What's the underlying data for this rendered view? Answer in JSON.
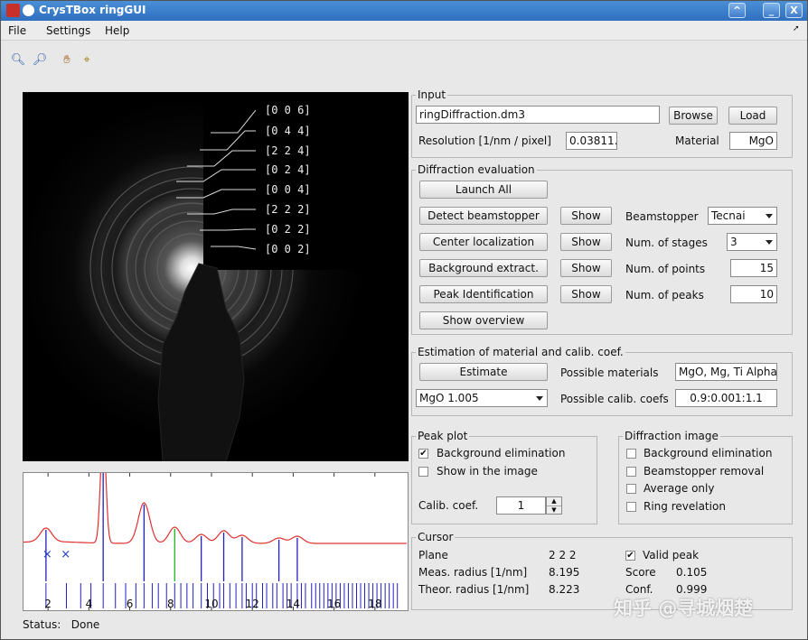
{
  "window": {
    "title": "CrysTBox ringGUI",
    "buttons": [
      "^",
      "_",
      "X"
    ]
  },
  "menu": [
    "File",
    "Settings",
    "Help"
  ],
  "toolbar": {
    "icons": [
      "zoom-in-icon",
      "zoom-out-icon",
      "pan-hand-icon",
      "data-cursor-icon"
    ]
  },
  "image": {
    "planes": [
      "[0  0  6]",
      "[0  4  4]",
      "[2  2  4]",
      "[0  2  4]",
      "[0  0  4]",
      "[2  2  2]",
      "[0  2  2]",
      "[0  0  2]"
    ]
  },
  "plot": {
    "xticks": [
      "2",
      "4",
      "6",
      "8",
      "10",
      "12",
      "14",
      "16",
      "18"
    ],
    "xlim": [
      0.8,
      19.6
    ],
    "peaks": [
      1.9,
      4.7,
      6.7,
      8.2,
      9.5,
      10.6,
      11.5,
      13.3,
      14.2
    ],
    "highlight_peak": 8.2,
    "theor_lines": [
      1.9,
      2.9,
      3.6,
      4.1,
      4.7,
      5.3,
      5.8,
      6.3,
      6.7,
      7.1,
      7.4,
      7.8,
      8.2,
      8.5,
      8.8,
      9.1,
      9.5,
      9.8,
      10.1,
      10.4,
      10.6,
      10.9,
      11.2,
      11.5,
      11.7,
      12.0,
      12.2,
      12.5,
      12.7,
      13.0,
      13.2,
      13.5,
      13.7,
      13.9,
      14.2,
      14.4,
      14.6,
      14.9,
      15.1,
      15.3,
      15.5,
      15.7,
      15.9,
      16.1,
      16.3,
      16.5,
      16.7,
      16.9,
      17.1,
      17.3,
      17.5,
      17.7,
      17.9,
      18.1,
      18.3,
      18.5,
      18.7,
      18.9,
      19.1
    ],
    "curve_color": "#e03030",
    "line_color": "#2020c0",
    "highlight_color": "#20b020"
  },
  "status": {
    "label": "Status:",
    "value": "Done"
  },
  "input": {
    "title": "Input",
    "file": "ringDiffraction.dm3",
    "browse": "Browse",
    "load": "Load",
    "res_label": "Resolution [1/nm / pixel]",
    "res_value": "0.03811․",
    "mat_label": "Material",
    "mat_value": "MgO"
  },
  "diffeval": {
    "title": "Diffraction evaluation",
    "launch": "Launch All",
    "detect": "Detect beamstopper",
    "center": "Center localization",
    "background": "Background extract.",
    "peak": "Peak Identification",
    "overview": "Show overview",
    "show": "Show",
    "beam_label": "Beamstopper",
    "beam_value": "Tecnai",
    "stages_label": "Num. of stages",
    "stages_value": "3",
    "points_label": "Num. of points",
    "points_value": "15",
    "peaks_label": "Num. of peaks",
    "peaks_value": "10"
  },
  "estimation": {
    "title": "Estimation of material and calib. coef.",
    "estimate": "Estimate",
    "pm_label": "Possible materials",
    "pm_value": "MgO, Mg, Ti Alpha",
    "sel_value": "MgO  1.005",
    "pc_label": "Possible calib. coefs",
    "pc_value": "0.9:0.001:1.1"
  },
  "peakplot": {
    "title": "Peak plot",
    "bg": "Background elimination",
    "show": "Show in the image",
    "calib_label": "Calib. coef.",
    "calib_value": "1"
  },
  "diffimage": {
    "title": "Diffraction image",
    "bg": "Background elimination",
    "beam": "Beamstopper removal",
    "avg": "Average only",
    "ring": "Ring revelation"
  },
  "cursor": {
    "title": "Cursor",
    "plane_label": "Plane",
    "plane_value": "2  2  2",
    "meas_label": "Meas. radius [1/nm]",
    "meas_value": "8.195",
    "theor_label": "Theor. radius [1/nm]",
    "theor_value": "8.223",
    "valid": "Valid peak",
    "score_label": "Score",
    "score_value": "0.105",
    "conf_label": "Conf.",
    "conf_value": "0.999"
  },
  "watermark": "知乎 @寻城烟楚"
}
